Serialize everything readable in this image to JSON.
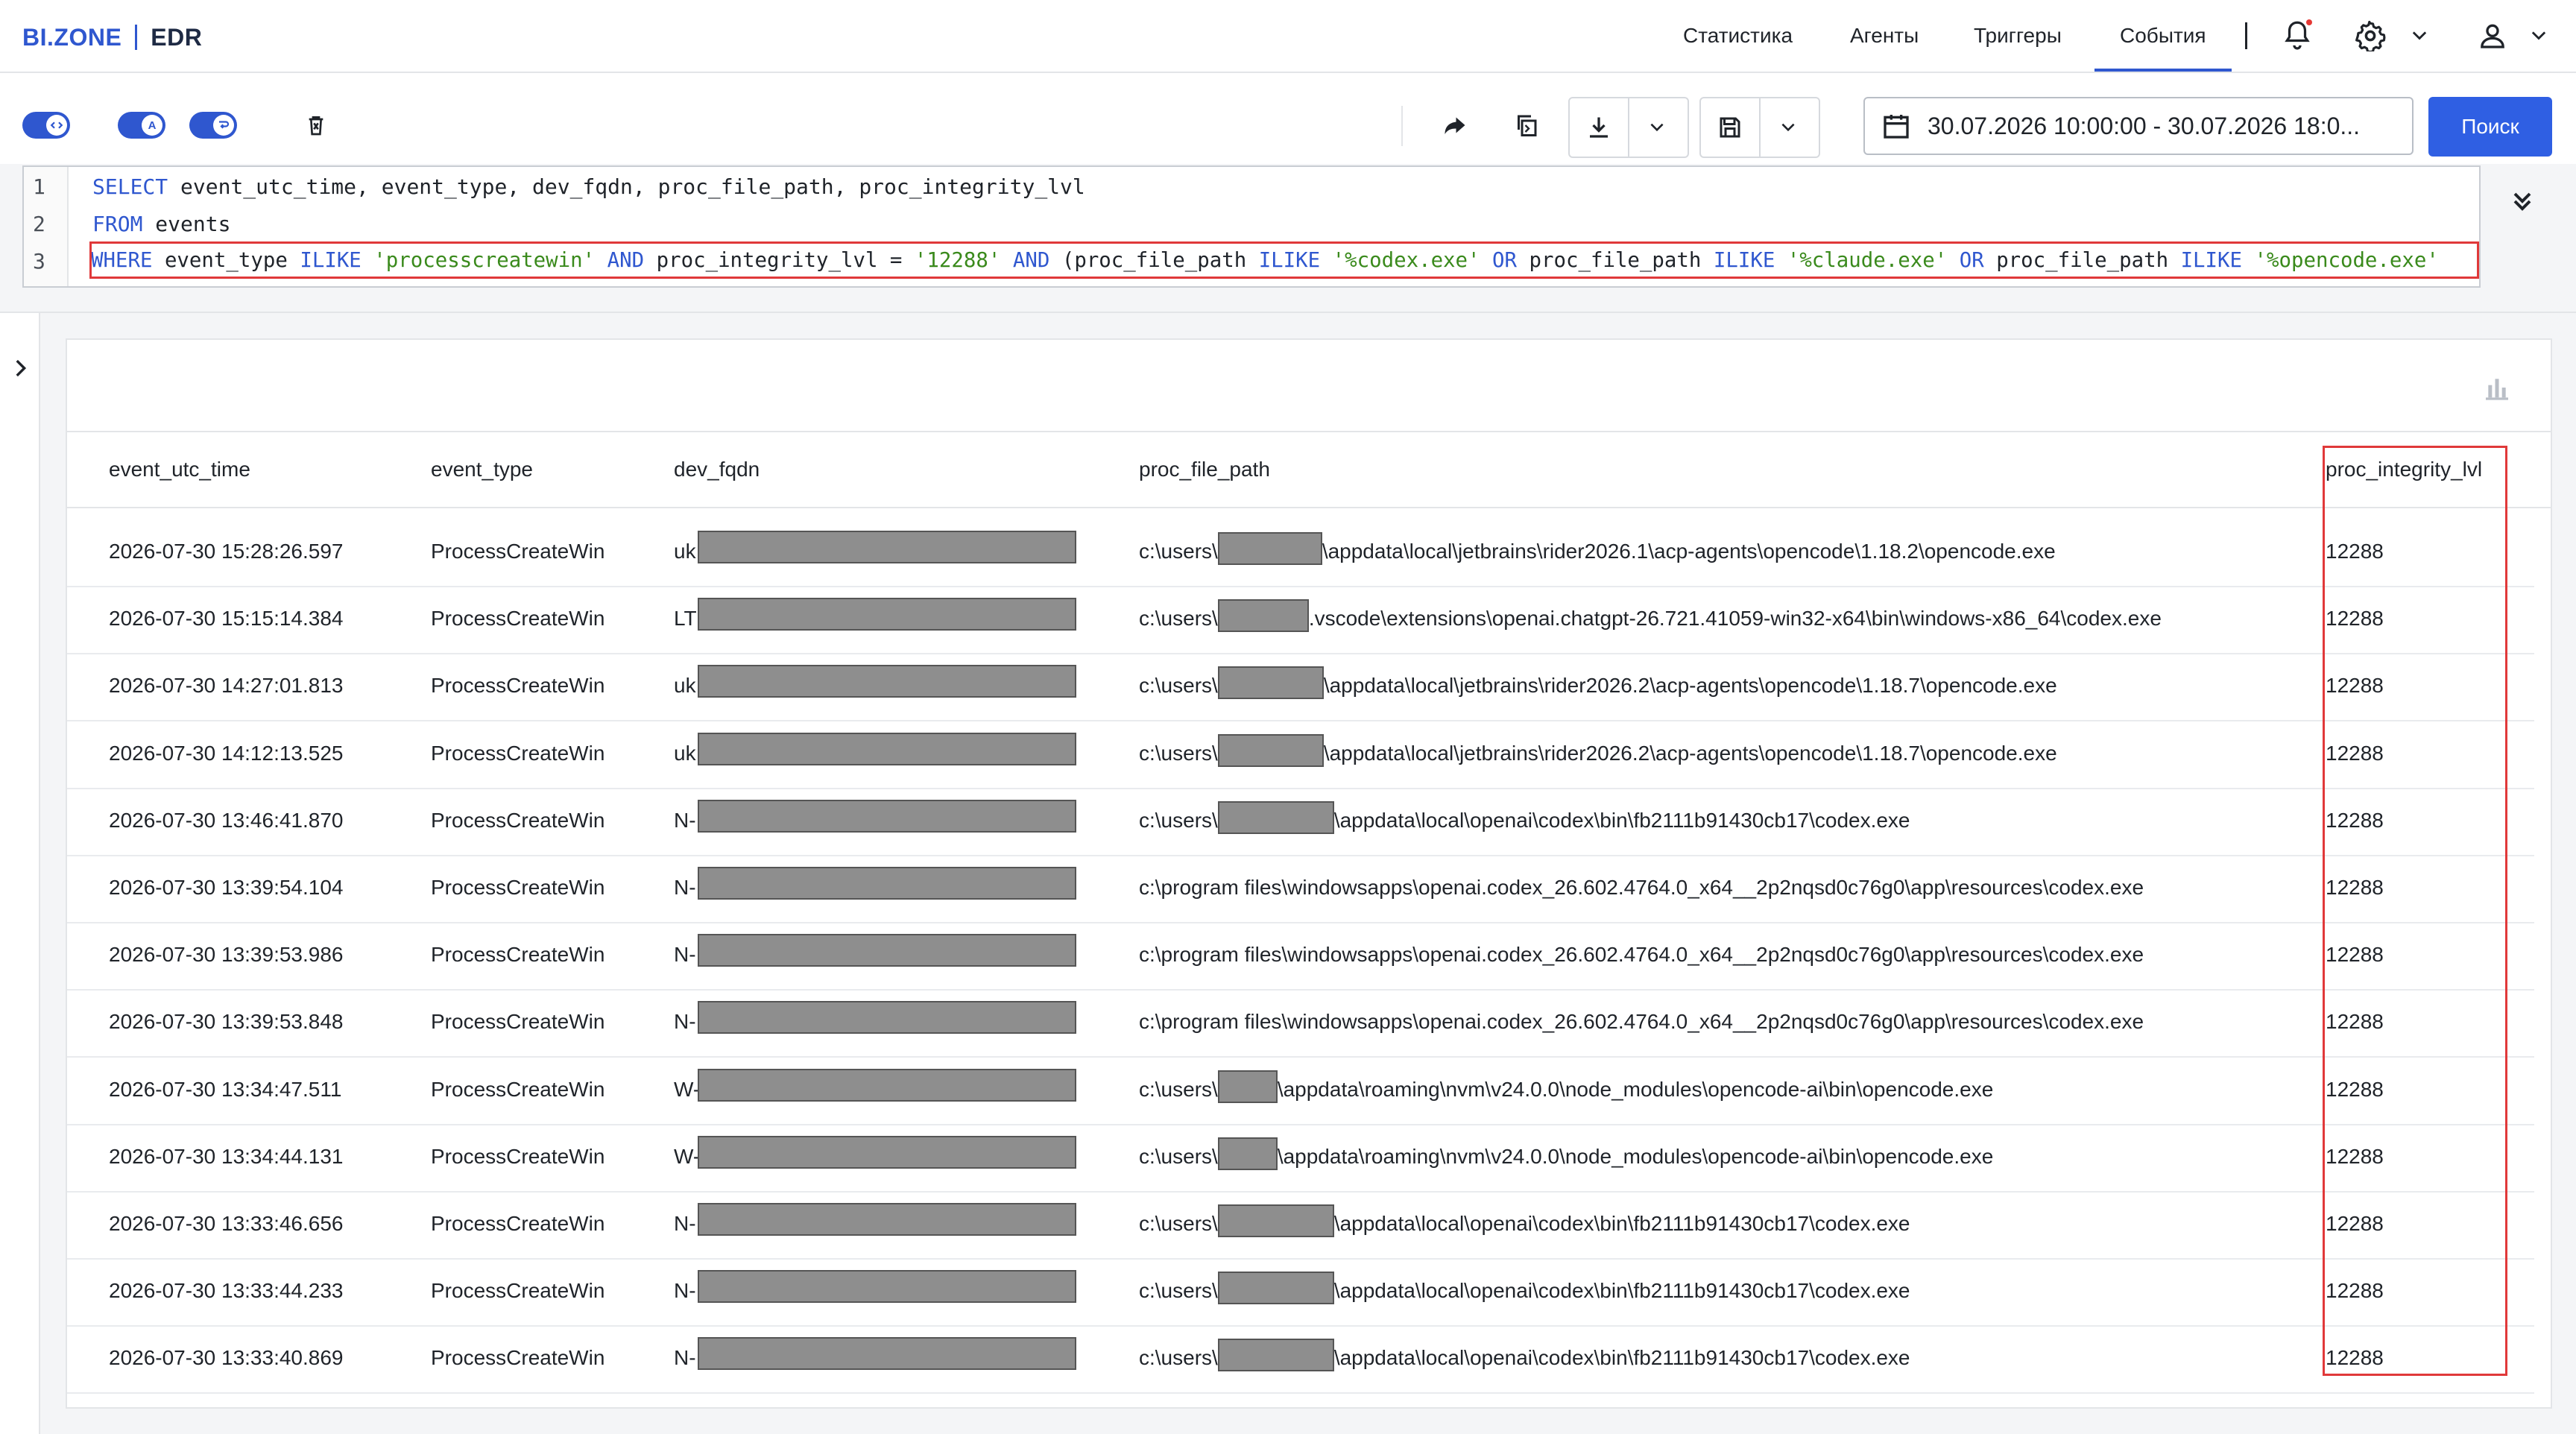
{
  "app": {
    "brand": "BI.ZONE",
    "product": "EDR"
  },
  "nav": {
    "items": [
      {
        "label": "Статистика"
      },
      {
        "label": "Агенты"
      },
      {
        "label": "Триггеры"
      },
      {
        "label": "События",
        "active": true
      }
    ],
    "icons": [
      "bell-icon",
      "gear-icon",
      "chevron-down-icon",
      "user-icon",
      "chevron-down-icon"
    ]
  },
  "toolbar": {
    "toggles": [
      {
        "icon": "code-icon",
        "on": true
      },
      {
        "icon": "autocomplete-icon",
        "on": true,
        "glyph": "A"
      },
      {
        "icon": "wrap-icon",
        "on": true
      }
    ],
    "icons": [
      "delete-icon",
      "share-icon",
      "copy-icon",
      "download-icon",
      "save-icon"
    ],
    "date_range": "30.07.2026 10:00:00 - 30.07.2026 18:0...",
    "search_label": "Поиск"
  },
  "editor": {
    "line_numbers": [
      "1",
      "2",
      "3"
    ]
  },
  "table": {
    "columns": [
      "event_utc_time",
      "event_type",
      "dev_fqdn",
      "proc_file_path",
      "proc_integrity_lvl"
    ],
    "rows": [
      {
        "time": "2026-07-30 15:28:26.597",
        "type": "ProcessCreateWin",
        "fqdn": "uk",
        "path_pre": "c:\\users\\",
        "path_post": "\\appdata\\local\\jetbrains\\rider2026.1\\acp-agents\\opencode\\1.18.2\\opencode.exe",
        "redact_w": 140,
        "lvl": "12288"
      },
      {
        "time": "2026-07-30 15:15:14.384",
        "type": "ProcessCreateWin",
        "fqdn": "LT",
        "path_pre": "c:\\users\\",
        "path_post": ".vscode\\extensions\\openai.chatgpt-26.721.41059-win32-x64\\bin\\windows-x86_64\\codex.exe",
        "redact_w": 122,
        "lvl": "12288"
      },
      {
        "time": "2026-07-30 14:27:01.813",
        "type": "ProcessCreateWin",
        "fqdn": "uk",
        "path_pre": "c:\\users\\",
        "path_post": "\\appdata\\local\\jetbrains\\rider2026.2\\acp-agents\\opencode\\1.18.7\\opencode.exe",
        "redact_w": 142,
        "lvl": "12288"
      },
      {
        "time": "2026-07-30 14:12:13.525",
        "type": "ProcessCreateWin",
        "fqdn": "uk",
        "path_pre": "c:\\users\\",
        "path_post": "\\appdata\\local\\jetbrains\\rider2026.2\\acp-agents\\opencode\\1.18.7\\opencode.exe",
        "redact_w": 142,
        "lvl": "12288"
      },
      {
        "time": "2026-07-30 13:46:41.870",
        "type": "ProcessCreateWin",
        "fqdn": "N-",
        "path_pre": "c:\\users\\",
        "path_post": "\\appdata\\local\\openai\\codex\\bin\\fb2111b91430cb17\\codex.exe",
        "redact_w": 156,
        "lvl": "12288"
      },
      {
        "time": "2026-07-30 13:39:54.104",
        "type": "ProcessCreateWin",
        "fqdn": "N-",
        "path_pre": "c:\\program files\\windowsapps\\openai.codex_26.602.4764.0_x64__2p2nqsd0c76g0\\app\\resources\\codex.exe",
        "path_post": "",
        "redact_w": 0,
        "lvl": "12288"
      },
      {
        "time": "2026-07-30 13:39:53.986",
        "type": "ProcessCreateWin",
        "fqdn": "N-",
        "path_pre": "c:\\program files\\windowsapps\\openai.codex_26.602.4764.0_x64__2p2nqsd0c76g0\\app\\resources\\codex.exe",
        "path_post": "",
        "redact_w": 0,
        "lvl": "12288"
      },
      {
        "time": "2026-07-30 13:39:53.848",
        "type": "ProcessCreateWin",
        "fqdn": "N-",
        "path_pre": "c:\\program files\\windowsapps\\openai.codex_26.602.4764.0_x64__2p2nqsd0c76g0\\app\\resources\\codex.exe",
        "path_post": "",
        "redact_w": 0,
        "lvl": "12288"
      },
      {
        "time": "2026-07-30 13:34:47.511",
        "type": "ProcessCreateWin",
        "fqdn": "W-",
        "path_pre": "c:\\users\\",
        "path_post": "\\appdata\\roaming\\nvm\\v24.0.0\\node_modules\\opencode-ai\\bin\\opencode.exe",
        "redact_w": 80,
        "lvl": "12288"
      },
      {
        "time": "2026-07-30 13:34:44.131",
        "type": "ProcessCreateWin",
        "fqdn": "W-",
        "path_pre": "c:\\users\\",
        "path_post": "\\appdata\\roaming\\nvm\\v24.0.0\\node_modules\\opencode-ai\\bin\\opencode.exe",
        "redact_w": 80,
        "lvl": "12288"
      },
      {
        "time": "2026-07-30 13:33:46.656",
        "type": "ProcessCreateWin",
        "fqdn": "N-",
        "path_pre": "c:\\users\\",
        "path_post": "\\appdata\\local\\openai\\codex\\bin\\fb2111b91430cb17\\codex.exe",
        "redact_w": 156,
        "lvl": "12288"
      },
      {
        "time": "2026-07-30 13:33:44.233",
        "type": "ProcessCreateWin",
        "fqdn": "N-",
        "path_pre": "c:\\users\\",
        "path_post": "\\appdata\\local\\openai\\codex\\bin\\fb2111b91430cb17\\codex.exe",
        "redact_w": 156,
        "lvl": "12288"
      },
      {
        "time": "2026-07-30 13:33:40.869",
        "type": "ProcessCreateWin",
        "fqdn": "N-",
        "path_pre": "c:\\users\\",
        "path_post": "\\appdata\\local\\openai\\codex\\bin\\fb2111b91430cb17\\codex.exe",
        "redact_w": 156,
        "lvl": "12288"
      }
    ]
  },
  "colors": {
    "accent": "#2f57cf",
    "search_button": "#2f5fe3",
    "highlight_red": "#e0393a",
    "sql_keyword": "#2f57cf",
    "sql_string": "#3a8a1c"
  }
}
